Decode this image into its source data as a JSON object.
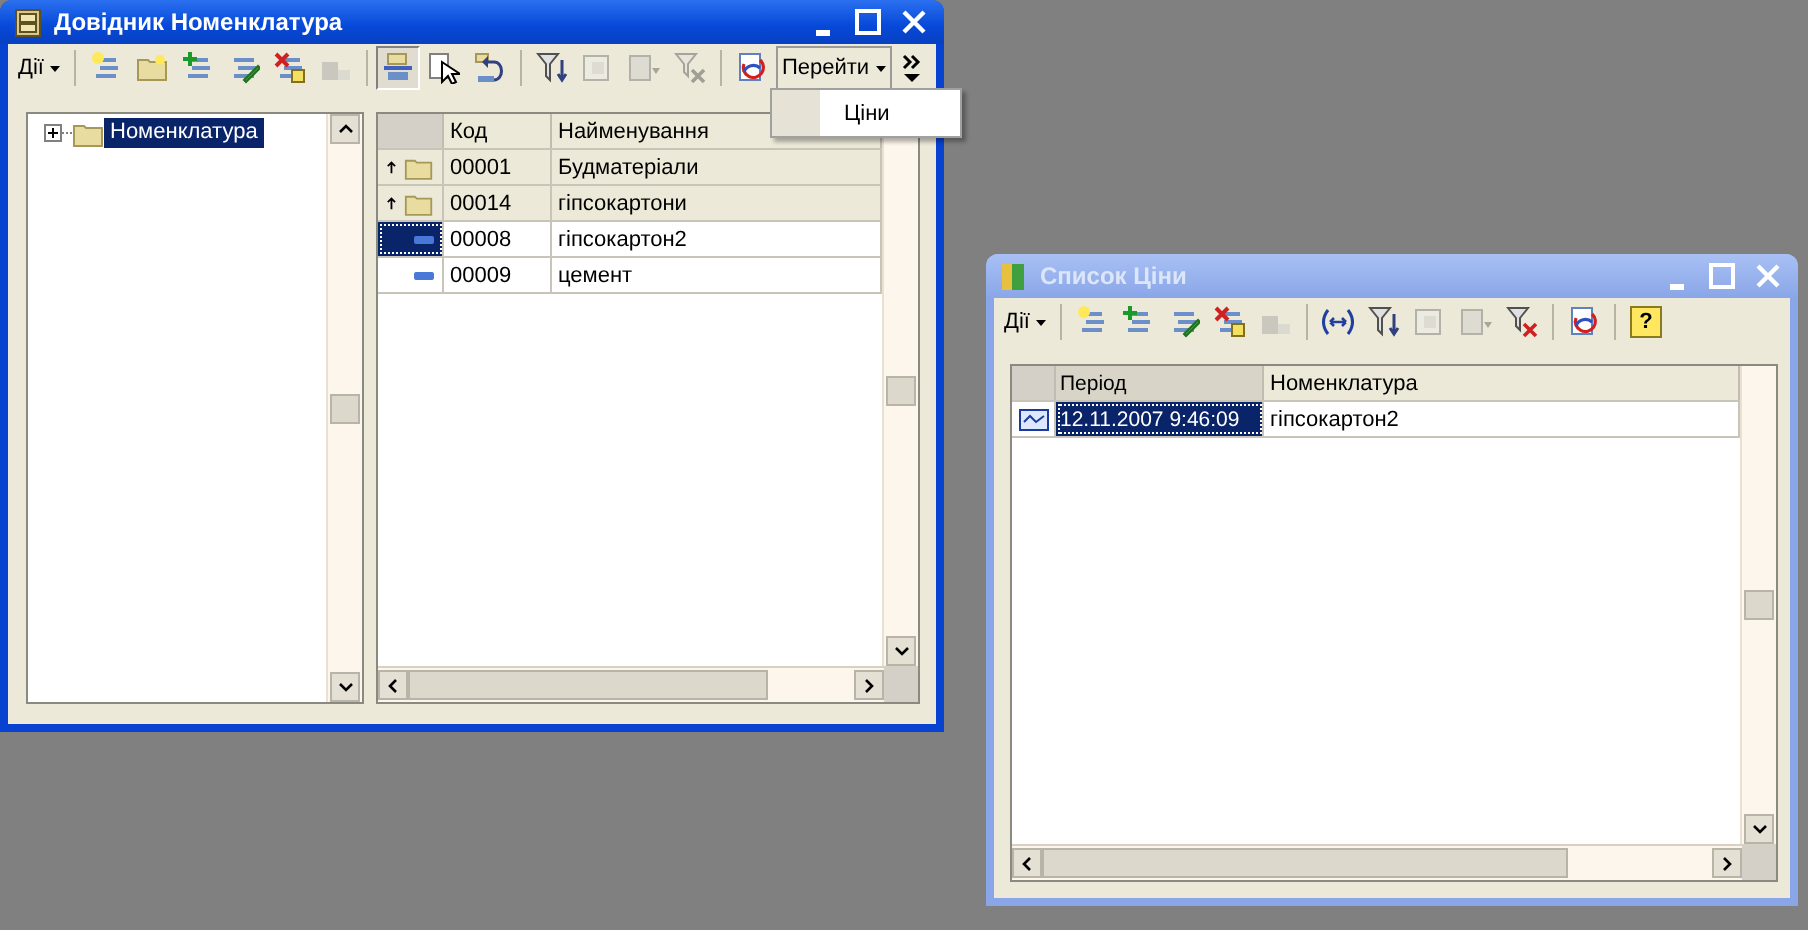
{
  "windows": [
    {
      "title": "Довідник Номенклатура",
      "active": true,
      "kind": "catalog",
      "toolbar": [
        {
          "kind": "menu",
          "label": "Дії",
          "disabled": false,
          "pressed": false
        },
        {
          "kind": "separator"
        },
        {
          "kind": "add",
          "disabled": false,
          "pressed": false
        },
        {
          "kind": "add-folder",
          "disabled": false,
          "pressed": false
        },
        {
          "kind": "copy",
          "disabled": false,
          "pressed": false
        },
        {
          "kind": "edit",
          "disabled": false,
          "pressed": false
        },
        {
          "kind": "delete",
          "disabled": false,
          "pressed": false
        },
        {
          "kind": "post",
          "disabled": true,
          "pressed": false
        },
        {
          "kind": "separator"
        },
        {
          "kind": "hierarchy",
          "disabled": false,
          "pressed": true
        },
        {
          "kind": "select",
          "disabled": false,
          "pressed": false
        },
        {
          "kind": "level-up",
          "disabled": false,
          "pressed": false
        },
        {
          "kind": "separator"
        },
        {
          "kind": "filter",
          "disabled": false,
          "pressed": false
        },
        {
          "kind": "filter-set",
          "disabled": true,
          "pressed": false
        },
        {
          "kind": "filter-menu",
          "disabled": true,
          "pressed": false
        },
        {
          "kind": "filter-clear",
          "disabled": true,
          "pressed": false
        },
        {
          "kind": "separator"
        },
        {
          "kind": "refresh",
          "disabled": false,
          "pressed": false
        },
        {
          "kind": "menu",
          "label": "Перейти",
          "disabled": false,
          "pressed": true
        },
        {
          "kind": "overflow",
          "disabled": false,
          "pressed": false
        }
      ],
      "tree": [
        {
          "label": "Номенклатура",
          "expanded": false,
          "selected": true
        }
      ],
      "table": {
        "columns": [
          "Код",
          "Найменування"
        ],
        "rows": [
          {
            "kind": "parent-folder",
            "cells": [
              "00001",
              "Будматеріали"
            ],
            "selected": false
          },
          {
            "kind": "parent-folder",
            "cells": [
              "00014",
              "гіпсокартони"
            ],
            "selected": false
          },
          {
            "kind": "item",
            "cells": [
              "00008",
              "гіпсокартон2"
            ],
            "selected": true
          },
          {
            "kind": "item",
            "cells": [
              "00009",
              "цемент"
            ],
            "selected": false
          }
        ]
      },
      "menu": {
        "items": [
          {
            "label": "Ціни"
          }
        ]
      }
    },
    {
      "title": "Список Ціни",
      "active": false,
      "kind": "register",
      "toolbar": [
        {
          "kind": "menu",
          "label": "Дії",
          "disabled": false,
          "pressed": false
        },
        {
          "kind": "separator"
        },
        {
          "kind": "add",
          "disabled": false,
          "pressed": false
        },
        {
          "kind": "copy",
          "disabled": false,
          "pressed": false
        },
        {
          "kind": "edit",
          "disabled": false,
          "pressed": false
        },
        {
          "kind": "delete",
          "disabled": false,
          "pressed": false
        },
        {
          "kind": "post",
          "disabled": true,
          "pressed": false
        },
        {
          "kind": "separator"
        },
        {
          "kind": "period",
          "disabled": false,
          "pressed": false
        },
        {
          "kind": "filter",
          "disabled": false,
          "pressed": false
        },
        {
          "kind": "filter-set",
          "disabled": true,
          "pressed": false
        },
        {
          "kind": "filter-menu",
          "disabled": true,
          "pressed": false
        },
        {
          "kind": "filter-clear",
          "disabled": false,
          "pressed": false
        },
        {
          "kind": "separator"
        },
        {
          "kind": "refresh",
          "disabled": false,
          "pressed": false
        },
        {
          "kind": "separator"
        },
        {
          "kind": "help",
          "label": "?",
          "disabled": false,
          "pressed": false
        }
      ],
      "table": {
        "columns": [
          "Період",
          "Номенклатура"
        ],
        "rows": [
          {
            "kind": "record",
            "cells": [
              "12.11.2007 9:46:09",
              "гіпсокартон2"
            ],
            "selected": true
          }
        ]
      }
    }
  ]
}
